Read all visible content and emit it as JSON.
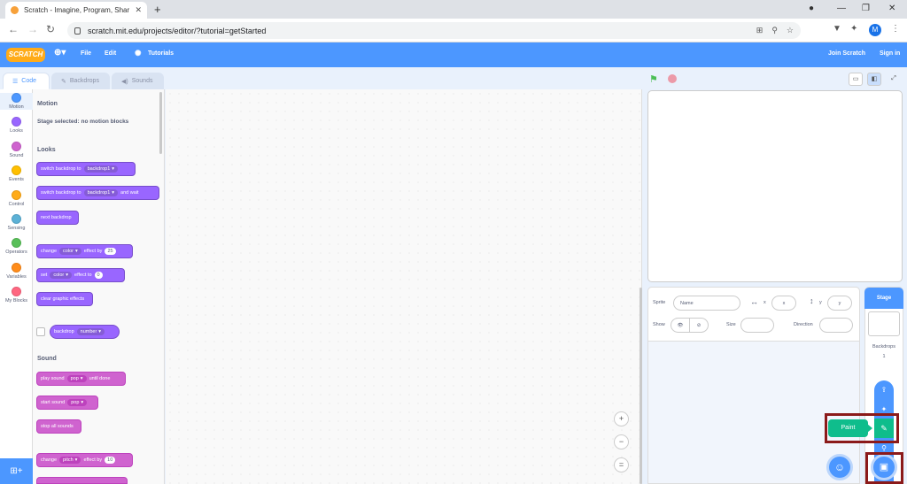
{
  "browser": {
    "tab_title": "Scratch - Imagine, Program, Shar",
    "url": "scratch.mit.edu/projects/editor/?tutorial=getStarted",
    "profile_initial": "M"
  },
  "menu": {
    "logo": "SCRATCH",
    "file": "File",
    "edit": "Edit",
    "tutorials": "Tutorials",
    "join": "Join Scratch",
    "signin": "Sign in"
  },
  "tabs": {
    "code": "Code",
    "backdrops": "Backdrops",
    "sounds": "Sounds"
  },
  "categories": [
    {
      "label": "Motion",
      "color": "#4c97ff"
    },
    {
      "label": "Looks",
      "color": "#9966ff"
    },
    {
      "label": "Sound",
      "color": "#cf63cf"
    },
    {
      "label": "Events",
      "color": "#ffbf00"
    },
    {
      "label": "Control",
      "color": "#ffab19"
    },
    {
      "label": "Sensing",
      "color": "#5cb1d6"
    },
    {
      "label": "Operators",
      "color": "#59c059"
    },
    {
      "label": "Variables",
      "color": "#ff8c1a"
    },
    {
      "label": "My Blocks",
      "color": "#ff6680"
    }
  ],
  "palette": {
    "motion_header": "Motion",
    "motion_note": "Stage selected: no motion blocks",
    "looks_header": "Looks",
    "sound_header": "Sound",
    "blocks": {
      "switch_backdrop": "switch backdrop to",
      "backdrop1": "backdrop1",
      "and_wait": "and wait",
      "next_backdrop": "next backdrop",
      "change": "change",
      "color": "color",
      "effect_by": "effect by",
      "effect_25": "25",
      "set": "set",
      "effect_to": "effect to",
      "effect_0": "0",
      "clear_effects": "clear graphic effects",
      "backdrop": "backdrop",
      "number": "number",
      "play_sound": "play sound",
      "pop": "pop",
      "until_done": "until done",
      "start_sound": "start sound",
      "stop_all_sounds": "stop all sounds",
      "pitch": "pitch",
      "pitch_val": "10"
    }
  },
  "sprite_info": {
    "sprite_label": "Sprite",
    "name_placeholder": "Name",
    "x_label": "x",
    "x_placeholder": "x",
    "y_label": "y",
    "y_placeholder": "y",
    "show_label": "Show",
    "size_label": "Size",
    "direction_label": "Direction"
  },
  "stage_pane": {
    "header": "Stage",
    "backdrops_label": "Backdrops",
    "backdrops_count": "1"
  },
  "paint_tooltip": "Paint"
}
